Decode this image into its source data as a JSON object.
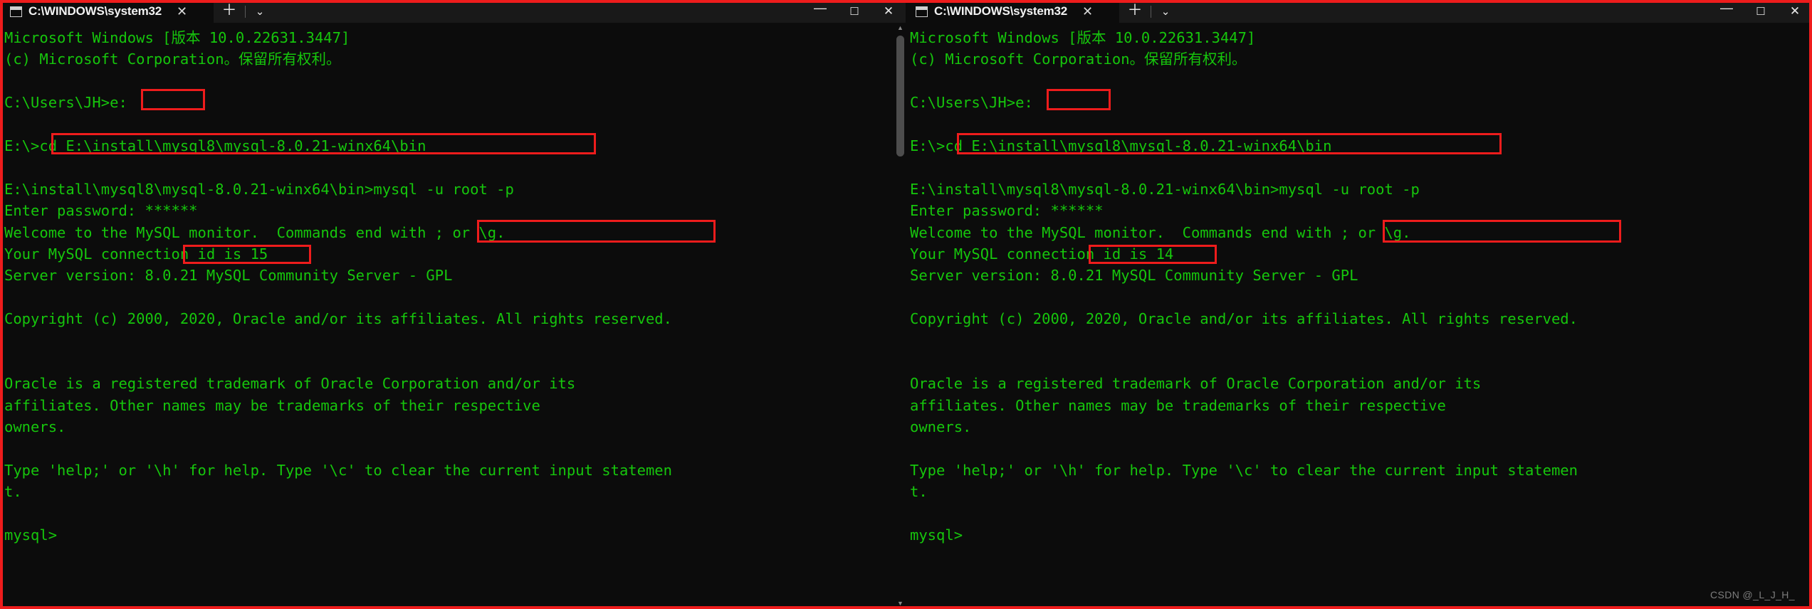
{
  "window": {
    "tab_title": "C:\\WINDOWS\\system32",
    "tab_icon": "console-icon",
    "close_tab_label": "✕",
    "new_tab_label": "＋",
    "dropdown_label": "⌄",
    "minimize_label": "—",
    "maximize_label": "☐",
    "close_label": "✕"
  },
  "colors": {
    "terminal_green": "#16c60c",
    "terminal_bg": "#0c0c0c",
    "annotation_red": "#ee1c1c",
    "titlebar_bg": "#191919"
  },
  "watermark": "CSDN @_L_J_H_",
  "scrollbar": {
    "up_arrow": "▲",
    "down_arrow": "▼"
  },
  "left_console": {
    "lines": [
      "Microsoft Windows [版本 10.0.22631.3447]",
      "(c) Microsoft Corporation。保留所有权利。",
      "",
      "C:\\Users\\JH>e:",
      "",
      "E:\\>cd E:\\install\\mysql8\\mysql-8.0.21-winx64\\bin",
      "",
      "E:\\install\\mysql8\\mysql-8.0.21-winx64\\bin>mysql -u root -p",
      "Enter password: ******",
      "Welcome to the MySQL monitor.  Commands end with ; or \\g.",
      "Your MySQL connection id is 15",
      "Server version: 8.0.21 MySQL Community Server - GPL",
      "",
      "Copyright (c) 2000, 2020, Oracle and/or its affiliates. All rights reserved.",
      "",
      "",
      "Oracle is a registered trademark of Oracle Corporation and/or its",
      "affiliates. Other names may be trademarks of their respective",
      "owners.",
      "",
      "Type 'help;' or '\\h' for help. Type '\\c' to clear the current input statemen",
      "t.",
      "",
      "mysql>"
    ],
    "annotations": [
      {
        "name": "drive-change-command",
        "text": "e:"
      },
      {
        "name": "cd-command",
        "text": "cd E:\\install\\mysql8\\mysql-8.0.21-winx64\\bin"
      },
      {
        "name": "mysql-login-command",
        "text": "mysql -u root -p"
      },
      {
        "name": "password-masked",
        "text": "******"
      }
    ]
  },
  "right_console": {
    "lines": [
      "Microsoft Windows [版本 10.0.22631.3447]",
      "(c) Microsoft Corporation。保留所有权利。",
      "",
      "C:\\Users\\JH>e:",
      "",
      "E:\\>cd E:\\install\\mysql8\\mysql-8.0.21-winx64\\bin",
      "",
      "E:\\install\\mysql8\\mysql-8.0.21-winx64\\bin>mysql -u root -p",
      "Enter password: ******",
      "Welcome to the MySQL monitor.  Commands end with ; or \\g.",
      "Your MySQL connection id is 14",
      "Server version: 8.0.21 MySQL Community Server - GPL",
      "",
      "Copyright (c) 2000, 2020, Oracle and/or its affiliates. All rights reserved.",
      "",
      "",
      "Oracle is a registered trademark of Oracle Corporation and/or its",
      "affiliates. Other names may be trademarks of their respective",
      "owners.",
      "",
      "Type 'help;' or '\\h' for help. Type '\\c' to clear the current input statemen",
      "t.",
      "",
      "mysql>"
    ],
    "annotations": [
      {
        "name": "drive-change-command",
        "text": "e:"
      },
      {
        "name": "cd-command",
        "text": "cd E:\\install\\mysql8\\mysql-8.0.21-winx64\\bin"
      },
      {
        "name": "mysql-login-command",
        "text": "mysql -u root -p"
      },
      {
        "name": "password-masked",
        "text": "******"
      }
    ]
  }
}
